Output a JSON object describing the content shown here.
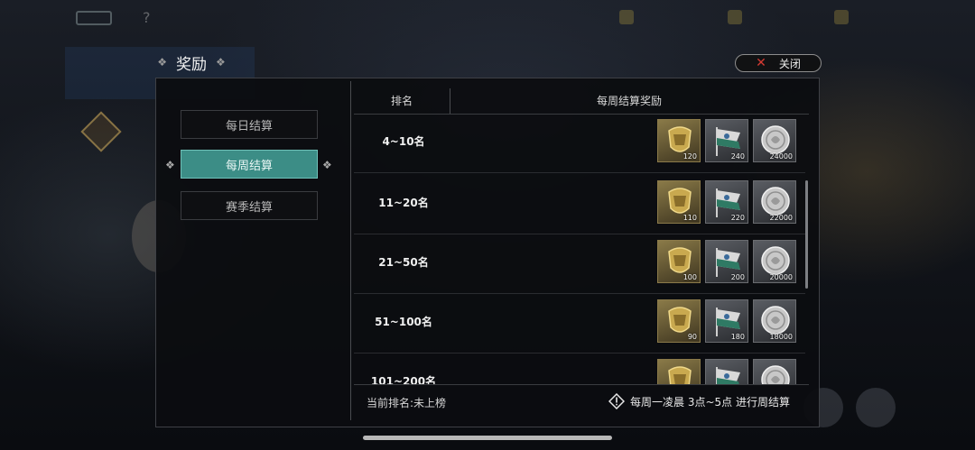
{
  "modal": {
    "title": "奖励",
    "close_label": "关闭"
  },
  "tabs": [
    {
      "label": "每日结算",
      "active": false
    },
    {
      "label": "每周结算",
      "active": true
    },
    {
      "label": "赛季结算",
      "active": false
    }
  ],
  "table": {
    "headers": {
      "rank": "排名",
      "reward": "每周结算奖励"
    },
    "rows": [
      {
        "rank": "4~10名",
        "rewards": [
          {
            "icon": "gold-shield-icon",
            "count": "120"
          },
          {
            "icon": "banner-flag-icon",
            "count": "240"
          },
          {
            "icon": "silver-coin-icon",
            "count": "24000"
          }
        ]
      },
      {
        "rank": "11~20名",
        "rewards": [
          {
            "icon": "gold-shield-icon",
            "count": "110"
          },
          {
            "icon": "banner-flag-icon",
            "count": "220"
          },
          {
            "icon": "silver-coin-icon",
            "count": "22000"
          }
        ]
      },
      {
        "rank": "21~50名",
        "rewards": [
          {
            "icon": "gold-shield-icon",
            "count": "100"
          },
          {
            "icon": "banner-flag-icon",
            "count": "200"
          },
          {
            "icon": "silver-coin-icon",
            "count": "20000"
          }
        ]
      },
      {
        "rank": "51~100名",
        "rewards": [
          {
            "icon": "gold-shield-icon",
            "count": "90"
          },
          {
            "icon": "banner-flag-icon",
            "count": "180"
          },
          {
            "icon": "silver-coin-icon",
            "count": "18000"
          }
        ]
      },
      {
        "rank": "101~200名",
        "rewards": [
          {
            "icon": "gold-shield-icon",
            "count": ""
          },
          {
            "icon": "banner-flag-icon",
            "count": ""
          },
          {
            "icon": "silver-coin-icon",
            "count": ""
          }
        ]
      }
    ]
  },
  "footer": {
    "current_rank": "当前排名:未上榜",
    "settle_info": "每周一凌晨 3点~5点 进行周结算"
  },
  "colors": {
    "tab_active": "#3c8d86",
    "close_x": "#d43a33",
    "modal_bg": "#0c0d10"
  }
}
